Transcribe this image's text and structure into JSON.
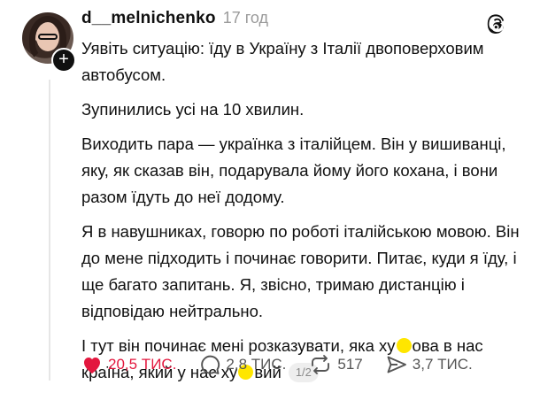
{
  "post": {
    "username": "d__melnichenko",
    "time": "17 год",
    "paragraphs": {
      "p1": "Уявіть ситуацію: їду в Україну з Італії двоповерховим автобусом.",
      "p2": "Зупинились усі на 10 хвилин.",
      "p3": "Виходить пара — українка з італійцем. Він у вишиванці, яку, як сказав він, подарувала йому його кохана, і вони разом їдуть до неї додому.",
      "p4": "Я в навушниках, говорю по роботі італійською мовою. Він до мене підходить і починає говорити. Питає, куди я їду, і ще багато запитань. Я, звісно, тримаю дистанцію і відповідаю нейтрально.",
      "p5a": "І тут він починає мені розказувати, яка ху",
      "p5b": "ова в нас країна, який у нас ху",
      "p5c": "вий"
    },
    "pager": "1/2"
  },
  "actions": {
    "likes": "20,5 ТИС.",
    "comments": "2,8 ТИС.",
    "reposts": "517",
    "shares": "3,7 ТИС."
  },
  "colors": {
    "like": "#e3173e",
    "highlight": "#ffe600"
  },
  "icons": [
    "plus-icon",
    "threads-logo-icon",
    "heart-icon",
    "comment-icon",
    "repost-icon",
    "share-icon"
  ]
}
